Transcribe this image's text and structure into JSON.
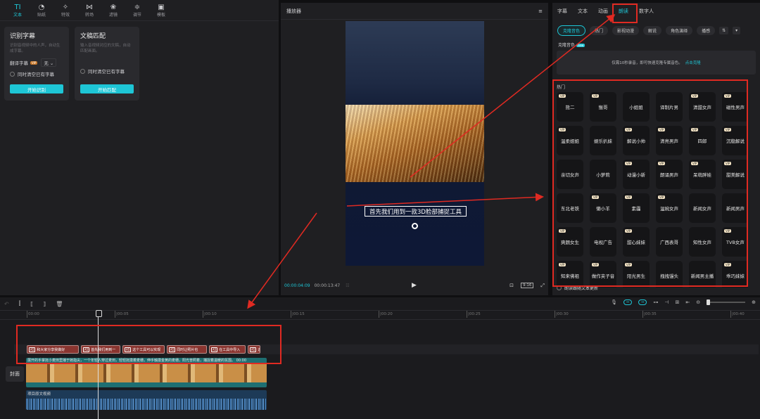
{
  "toolbar": {
    "tabs": [
      {
        "label": "文本",
        "icon": "text-icon",
        "glyph": "TI",
        "active": true
      },
      {
        "label": "贴纸",
        "icon": "sticker-icon",
        "glyph": "◔"
      },
      {
        "label": "特效",
        "icon": "effects-icon",
        "glyph": "✧"
      },
      {
        "label": "转场",
        "icon": "transition-icon",
        "glyph": "⋈"
      },
      {
        "label": "滤镜",
        "icon": "filter-icon",
        "glyph": "❀"
      },
      {
        "label": "调节",
        "icon": "adjust-icon",
        "glyph": "≑"
      },
      {
        "label": "模板",
        "icon": "template-icon",
        "glyph": "▣"
      }
    ]
  },
  "cards": {
    "recognize": {
      "title": "识别字幕",
      "desc": "识别音视频中的人声，自动生成字幕。",
      "translate_label": "翻译字幕",
      "badge": "VIP",
      "select_value": "无",
      "checkbox_label": "同时清空已有字幕",
      "button": "开始识别"
    },
    "lyrics": {
      "title": "文稿匹配",
      "desc": "输入音视频对应的文稿，自动匹配画面。",
      "checkbox_label": "同时清空已有字幕",
      "button": "开始匹配"
    }
  },
  "player": {
    "title": "播放器",
    "subtitle": "首先我们用到一款3D脸部捕捉工具",
    "time_current": "00:00:04:09",
    "time_total": "00:00:13:47",
    "ratio": "9:16"
  },
  "right": {
    "tabs": [
      {
        "label": "字幕"
      },
      {
        "label": "文本"
      },
      {
        "label": "动画"
      },
      {
        "label": "朗读",
        "active": true
      },
      {
        "label": "数字人"
      }
    ],
    "filters": [
      "克隆音色",
      "热门",
      "影视动漫",
      "解说",
      "角色演绎",
      "播感"
    ],
    "clone_label": "克隆音色",
    "new_badge": "new",
    "clone_desc": "仅需10秒录音，即可快速克隆专属音色。",
    "clone_link": "点击克隆",
    "section_title": "热门",
    "vip_badge": "VIP",
    "voices": [
      {
        "name": "熊二",
        "vip": true
      },
      {
        "name": "猴哥",
        "vip": true
      },
      {
        "name": "小姐姐",
        "vip": false
      },
      {
        "name": "译制片男",
        "vip": false
      },
      {
        "name": "清甜女声",
        "vip": true
      },
      {
        "name": "磁性男声",
        "vip": true
      },
      {
        "name": "温柔姐姐",
        "vip": true
      },
      {
        "name": "娱乐扒妹",
        "vip": false
      },
      {
        "name": "解说小帅",
        "vip": true
      },
      {
        "name": "清亮男声",
        "vip": true
      },
      {
        "name": "四郎",
        "vip": true
      },
      {
        "name": "沉稳解说",
        "vip": true
      },
      {
        "name": "亲切女声",
        "vip": false
      },
      {
        "name": "小萝莉",
        "vip": false
      },
      {
        "name": "动漫小新",
        "vip": true
      },
      {
        "name": "朗诵男声",
        "vip": true
      },
      {
        "name": "呆萌胖娃",
        "vip": true
      },
      {
        "name": "甜美解说",
        "vip": true
      },
      {
        "name": "东北老铁",
        "vip": false
      },
      {
        "name": "懒小羊",
        "vip": true
      },
      {
        "name": "素霾",
        "vip": true
      },
      {
        "name": "温婉女声",
        "vip": true
      },
      {
        "name": "新闻女声",
        "vip": false
      },
      {
        "name": "新闻男声",
        "vip": false
      },
      {
        "name": "爽朗女生",
        "vip": true
      },
      {
        "name": "电视广告",
        "vip": false
      },
      {
        "name": "甜心妹妹",
        "vip": true
      },
      {
        "name": "广西表哥",
        "vip": false
      },
      {
        "name": "知性女声",
        "vip": false
      },
      {
        "name": "TVB女声",
        "vip": true
      },
      {
        "name": "知来佛祖",
        "vip": true
      },
      {
        "name": "做作夹子音",
        "vip": true
      },
      {
        "name": "阳光男生",
        "vip": true
      },
      {
        "name": "拽拽馒头",
        "vip": false
      },
      {
        "name": "新闻男主播",
        "vip": false
      },
      {
        "name": "乖巧妹妹",
        "vip": true
      }
    ],
    "footer_checkbox": "朗读跟随文本更新",
    "footer_button": "开始朗读"
  },
  "timeline": {
    "ticks": [
      "00:00",
      "|00:05",
      "|00:10",
      "|00:15",
      "|00:20",
      "|00:25",
      "|00:30",
      "|00:35",
      "|00:40"
    ],
    "subtitle_clips": [
      "和大家分享我做好",
      "首先我们用到一",
      "这个工具可以实现",
      "同时让照片也",
      "在工具中导入",
      "选"
    ],
    "clip_tag": "A5",
    "cover_label": "封面",
    "video_label": "展开的手掌抚小麦田里播于她指尖，一个年轻人穿过麦田，轻轻抚摸着麦穗，伸手触摸金黄的麦穗，阳光普照着，捕捉着温暖的氛围。  00:00",
    "audio_label": "项目原文视频"
  },
  "colors": {
    "accent": "#1ec6d6",
    "annotation": "#e02a22"
  }
}
